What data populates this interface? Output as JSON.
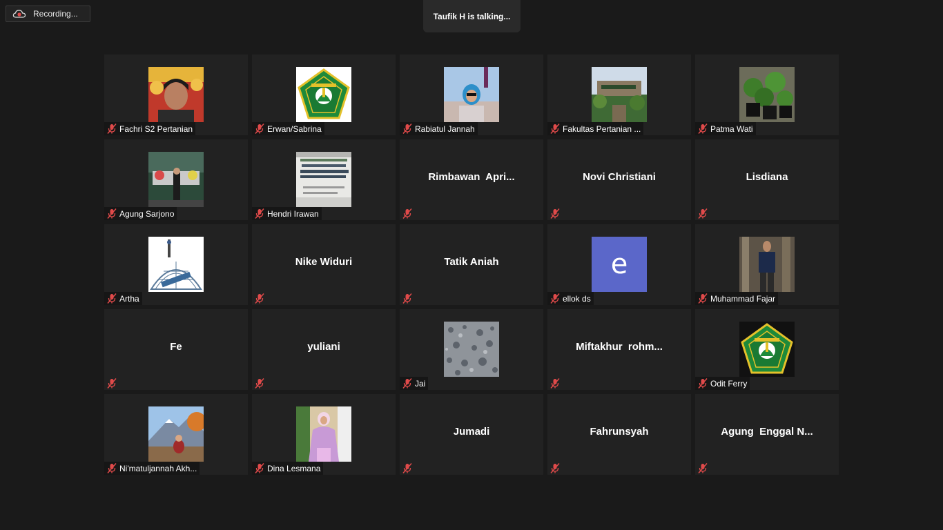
{
  "recording": {
    "label": "Recording...",
    "icon": "cloud-record-icon",
    "color": "#e04a4a"
  },
  "talking": {
    "text": "Taufik H is talking..."
  },
  "colors": {
    "background": "#1a1a1a",
    "tile": "#222222",
    "mic_muted": "#e04a4a",
    "letter_avatar": "#5b67c9"
  },
  "participants": [
    {
      "name": "Fachri S2 Pertanian",
      "video": "photo",
      "muted": true
    },
    {
      "name": "Erwan/Sabrina",
      "video": "logo-green",
      "muted": true
    },
    {
      "name": "Rabiatul Jannah",
      "video": "photo",
      "muted": true
    },
    {
      "name": "Fakultas Pertanian ...",
      "video": "photo",
      "muted": true
    },
    {
      "name": "Patma Wati",
      "video": "photo",
      "muted": true
    },
    {
      "name": "Agung Sarjono",
      "video": "photo",
      "muted": true
    },
    {
      "name": "Hendri Irawan",
      "video": "photo",
      "muted": true
    },
    {
      "name": "Rimbawan  Apri...",
      "video": "none",
      "muted": true
    },
    {
      "name": "Novi Christiani",
      "video": "none",
      "muted": true
    },
    {
      "name": "Lisdiana",
      "video": "none",
      "muted": true
    },
    {
      "name": "Artha",
      "video": "photo",
      "muted": true
    },
    {
      "name": "Nike Widuri",
      "video": "none",
      "muted": true
    },
    {
      "name": "Tatik Aniah",
      "video": "none",
      "muted": true
    },
    {
      "name": "ellok ds",
      "video": "letter",
      "letter": "e",
      "muted": true
    },
    {
      "name": "Muhammad Fajar",
      "video": "photo",
      "muted": true
    },
    {
      "name": "Fe",
      "video": "none",
      "muted": true
    },
    {
      "name": "yuliani",
      "video": "none",
      "muted": true
    },
    {
      "name": "Jai",
      "video": "photo",
      "muted": true
    },
    {
      "name": "Miftakhur  rohm...",
      "video": "none",
      "muted": true
    },
    {
      "name": "Odit Ferry",
      "video": "logo-green",
      "muted": true
    },
    {
      "name": "Ni'matuljannah Akh...",
      "video": "photo",
      "muted": true
    },
    {
      "name": "Dina Lesmana",
      "video": "photo",
      "muted": true
    },
    {
      "name": "Jumadi",
      "video": "none",
      "muted": true
    },
    {
      "name": "Fahrunsyah",
      "video": "none",
      "muted": true
    },
    {
      "name": "Agung  Enggal N...",
      "video": "none",
      "muted": true
    }
  ]
}
